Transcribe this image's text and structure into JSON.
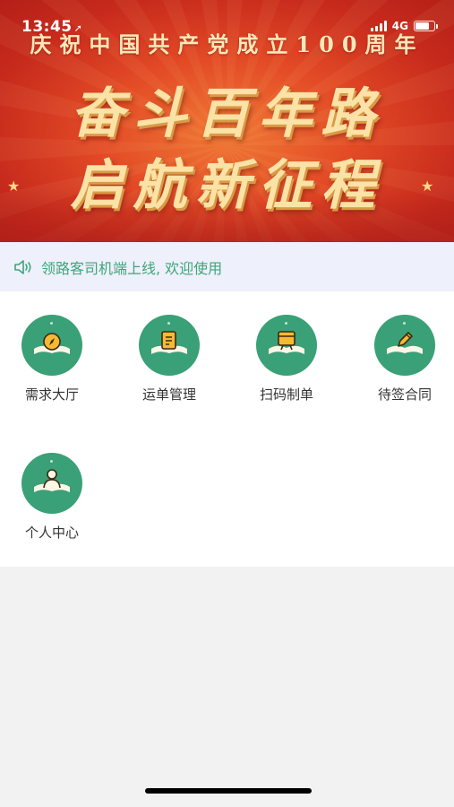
{
  "status": {
    "time": "13:45",
    "network": "4G"
  },
  "banner": {
    "top_line": "庆祝中国共产党成立100周年",
    "line1": "奋斗百年路",
    "line2": "启航新征程"
  },
  "notice": {
    "text": "领路客司机端上线, 欢迎使用",
    "icon": "speaker-icon"
  },
  "menu": {
    "items": [
      {
        "label": "需求大厅",
        "icon": "compass-icon"
      },
      {
        "label": "运单管理",
        "icon": "document-icon"
      },
      {
        "label": "扫码制单",
        "icon": "cart-icon"
      },
      {
        "label": "待签合同",
        "icon": "pen-icon"
      },
      {
        "label": "个人中心",
        "icon": "user-icon"
      }
    ]
  },
  "colors": {
    "icon_bg": "#3aa077",
    "notice_text": "#3ea57a",
    "notice_bg": "#eef0fb",
    "banner_red": "#d83a22"
  }
}
